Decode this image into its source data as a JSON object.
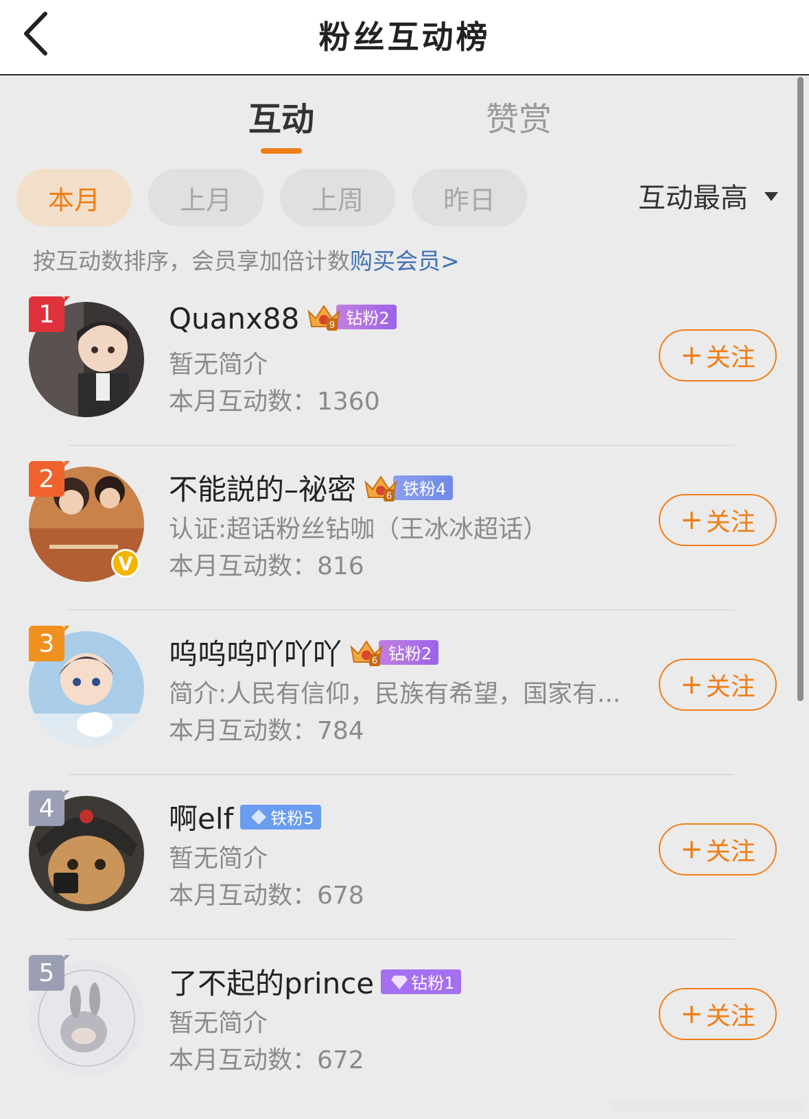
{
  "header": {
    "title": "粉丝互动榜"
  },
  "tabs": [
    {
      "label": "互动",
      "active": true
    },
    {
      "label": "赞赏",
      "active": false
    }
  ],
  "periods": [
    {
      "label": "本月",
      "active": true
    },
    {
      "label": "上月",
      "active": false
    },
    {
      "label": "上周",
      "active": false
    },
    {
      "label": "昨日",
      "active": false
    }
  ],
  "sort": {
    "label": "互动最高"
  },
  "hint": {
    "text": "按互动数排序，会员享加倍计数",
    "link": "购买会员>"
  },
  "follow_label": "关注",
  "follow_plus": "+",
  "colors": {
    "accent": "#f07d16",
    "link": "#3f6fb4",
    "background": "#ebebeb"
  },
  "fans": [
    {
      "rank": "1",
      "name": "Quanx88",
      "badge": "钻粉2",
      "crown_level": "9",
      "bio": "暂无简介",
      "count": "本月互动数：1360"
    },
    {
      "rank": "2",
      "name": "不能説的–祕密",
      "badge": "铁粉4",
      "crown_level": "6",
      "bio": "认证:超话粉丝钻咖（王冰冰超话）",
      "count": "本月互动数：816",
      "verified": "V"
    },
    {
      "rank": "3",
      "name": "呜呜呜吖吖吖",
      "badge": "钻粉2",
      "crown_level": "6",
      "bio": "简介:人民有信仰，民族有希望，国家有...",
      "count": "本月互动数：784"
    },
    {
      "rank": "4",
      "name": "啊elf",
      "badge": "铁粉5",
      "bio": "暂无简介",
      "count": "本月互动数：678"
    },
    {
      "rank": "5",
      "name": "了不起的prince",
      "badge": "钻粉1",
      "bio": "暂无简介",
      "count": "本月互动数：672"
    }
  ]
}
